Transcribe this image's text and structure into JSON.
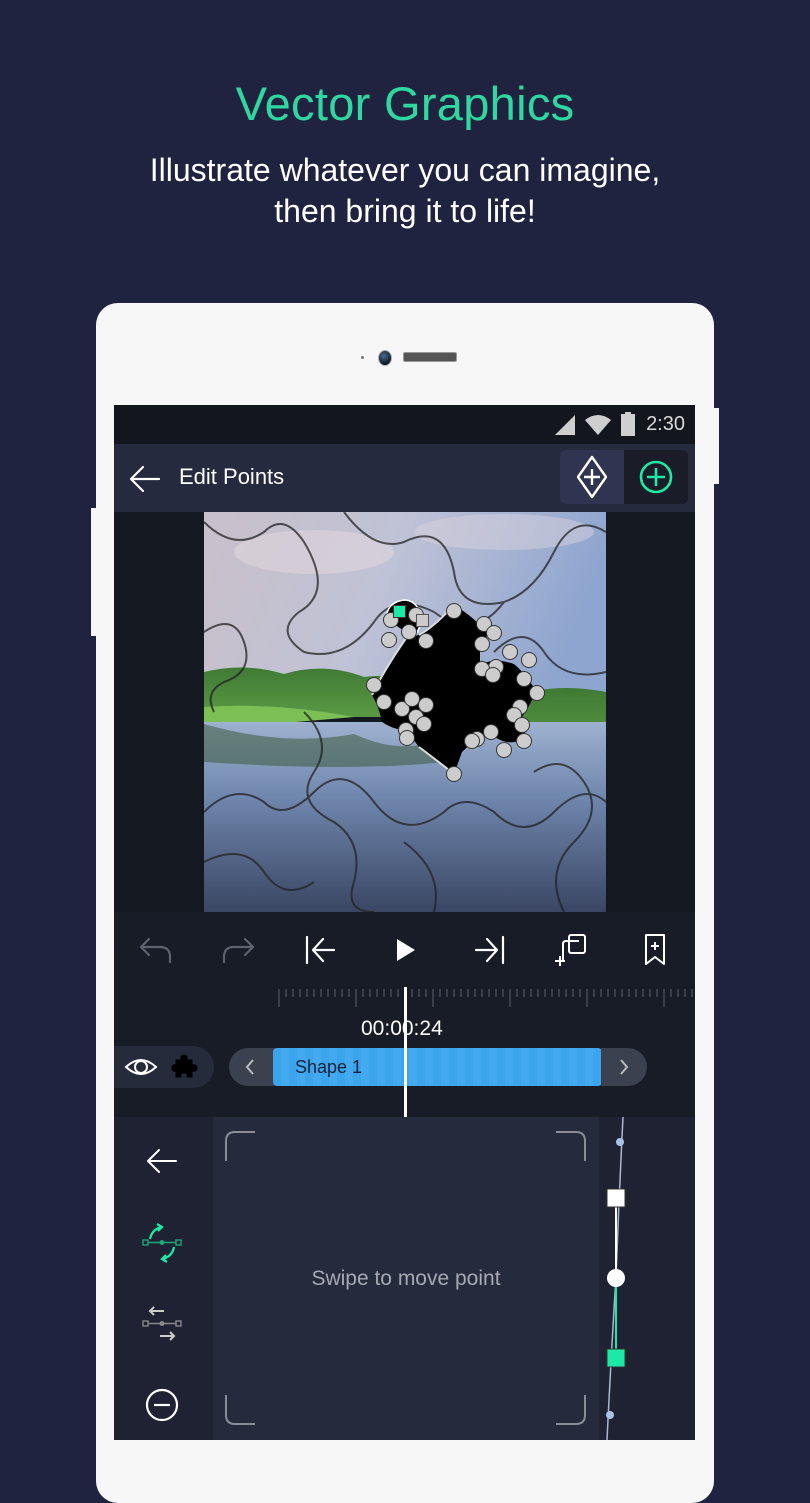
{
  "promo": {
    "headline": "Vector Graphics",
    "subline_1": "Illustrate whatever you can imagine,",
    "subline_2": "then bring it to life!"
  },
  "status_bar": {
    "time": "2:30",
    "icons": [
      "signal-icon",
      "wifi-icon",
      "battery-icon"
    ]
  },
  "app_bar": {
    "back_icon": "arrow-left-icon",
    "title": "Edit Points",
    "actions": [
      {
        "name": "add-diamond-point",
        "icon": "diamond-plus-icon",
        "selected": true
      },
      {
        "name": "add-point",
        "icon": "circle-plus-icon",
        "selected": false
      }
    ]
  },
  "canvas": {
    "image": "puzzle landscape with lake and trees",
    "shape_fill": "#000000",
    "point_color": "#cccccc",
    "selected_point_color": "#1de9a6"
  },
  "toolbar": {
    "buttons": [
      {
        "name": "undo",
        "icon": "undo-icon",
        "enabled": false
      },
      {
        "name": "redo",
        "icon": "redo-icon",
        "enabled": false
      },
      {
        "name": "jump-to-start",
        "icon": "skip-start-icon",
        "enabled": true
      },
      {
        "name": "play",
        "icon": "play-icon",
        "enabled": true
      },
      {
        "name": "jump-to-end",
        "icon": "skip-end-icon",
        "enabled": true
      },
      {
        "name": "duplicate",
        "icon": "duplicate-icon",
        "enabled": true
      },
      {
        "name": "add-bookmark",
        "icon": "bookmark-plus-icon",
        "enabled": true
      }
    ]
  },
  "timeline": {
    "timecode": "00:00:24",
    "track": {
      "label": "Shape 1",
      "color": "#3ba4ec"
    },
    "visibility_icon": "eye-icon",
    "layer_type_icon": "puzzle-icon"
  },
  "edit_panel": {
    "tools": [
      {
        "name": "back",
        "icon": "arrow-left-icon",
        "active": false
      },
      {
        "name": "rotate-handles",
        "icon": "rotate-handles-icon",
        "active": true
      },
      {
        "name": "flip-handles",
        "icon": "swap-handles-icon",
        "active": false
      },
      {
        "name": "remove-point",
        "icon": "minus-circle-icon",
        "active": false
      }
    ],
    "hint": "Swipe to move point"
  },
  "colors": {
    "background": "#1f2340",
    "accent": "#2fd8a0",
    "appbar": "#252a3f",
    "track": "#3ba4ec"
  }
}
